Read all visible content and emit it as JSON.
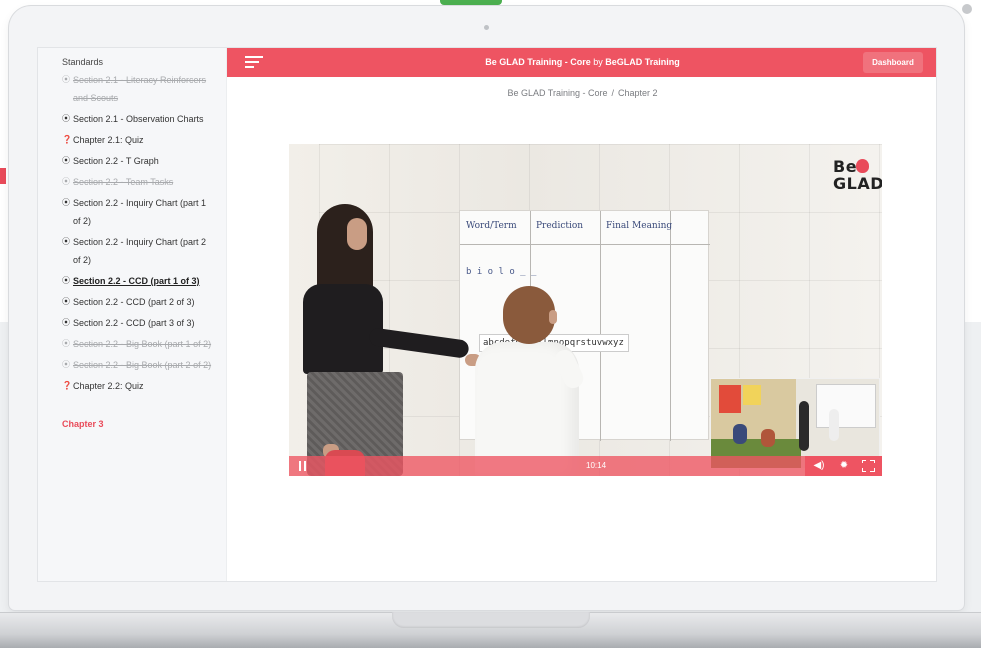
{
  "sidebar": {
    "section_title": "Standards",
    "items": [
      {
        "label": "Section 2.1 - Literacy Reinforcers and Scouts",
        "icon": "play-circle-icon",
        "state": "done"
      },
      {
        "label": "Section 2.1 - Observation Charts",
        "icon": "play-circle-icon",
        "state": "normal"
      },
      {
        "label": "Chapter 2.1: Quiz",
        "icon": "question-circle-icon",
        "state": "normal"
      },
      {
        "label": "Section 2.2 - T Graph",
        "icon": "play-circle-icon",
        "state": "normal"
      },
      {
        "label": "Section 2.2 - Team Tasks",
        "icon": "play-circle-icon",
        "state": "done"
      },
      {
        "label": "Section 2.2 - Inquiry Chart (part 1 of 2)",
        "icon": "play-circle-icon",
        "state": "normal"
      },
      {
        "label": "Section 2.2 - Inquiry Chart (part 2 of 2)",
        "icon": "play-circle-icon",
        "state": "normal"
      },
      {
        "label": "Section 2.2 - CCD (part 1 of 3)",
        "icon": "play-circle-icon",
        "state": "active"
      },
      {
        "label": "Section 2.2 - CCD (part 2 of 3)",
        "icon": "play-circle-icon",
        "state": "normal"
      },
      {
        "label": "Section 2.2 - CCD (part 3 of 3)",
        "icon": "play-circle-icon",
        "state": "normal"
      },
      {
        "label": "Section 2.2 - Big Book (part 1 of 2)",
        "icon": "play-circle-icon",
        "state": "done"
      },
      {
        "label": "Section 2.2 - Big Book (part 2 of 2)",
        "icon": "play-circle-icon",
        "state": "done"
      },
      {
        "label": "Chapter 2.2: Quiz",
        "icon": "question-circle-icon",
        "state": "normal"
      }
    ],
    "next_chapter": "Chapter 3"
  },
  "header": {
    "course_name": "Be GLAD Training - Core",
    "by_text": "by",
    "author": "BeGLAD Training",
    "dashboard_label": "Dashboard",
    "menu_icon": "hamburger-icon"
  },
  "breadcrumb": {
    "course": "Be GLAD Training - Core",
    "separator": "/",
    "chapter": "Chapter 2"
  },
  "video": {
    "logo_top": "Be",
    "logo_bottom": "GLAD",
    "time": "10:14",
    "chart_headers": [
      "Word/Term",
      "Prediction",
      "Final Meaning"
    ],
    "chart_row": "b i o l o _ _",
    "alphabet": "abcdefghijklmnopqrstuvwxyz"
  },
  "colors": {
    "accent": "#ee5462",
    "chapter_link": "#e94b5a"
  }
}
